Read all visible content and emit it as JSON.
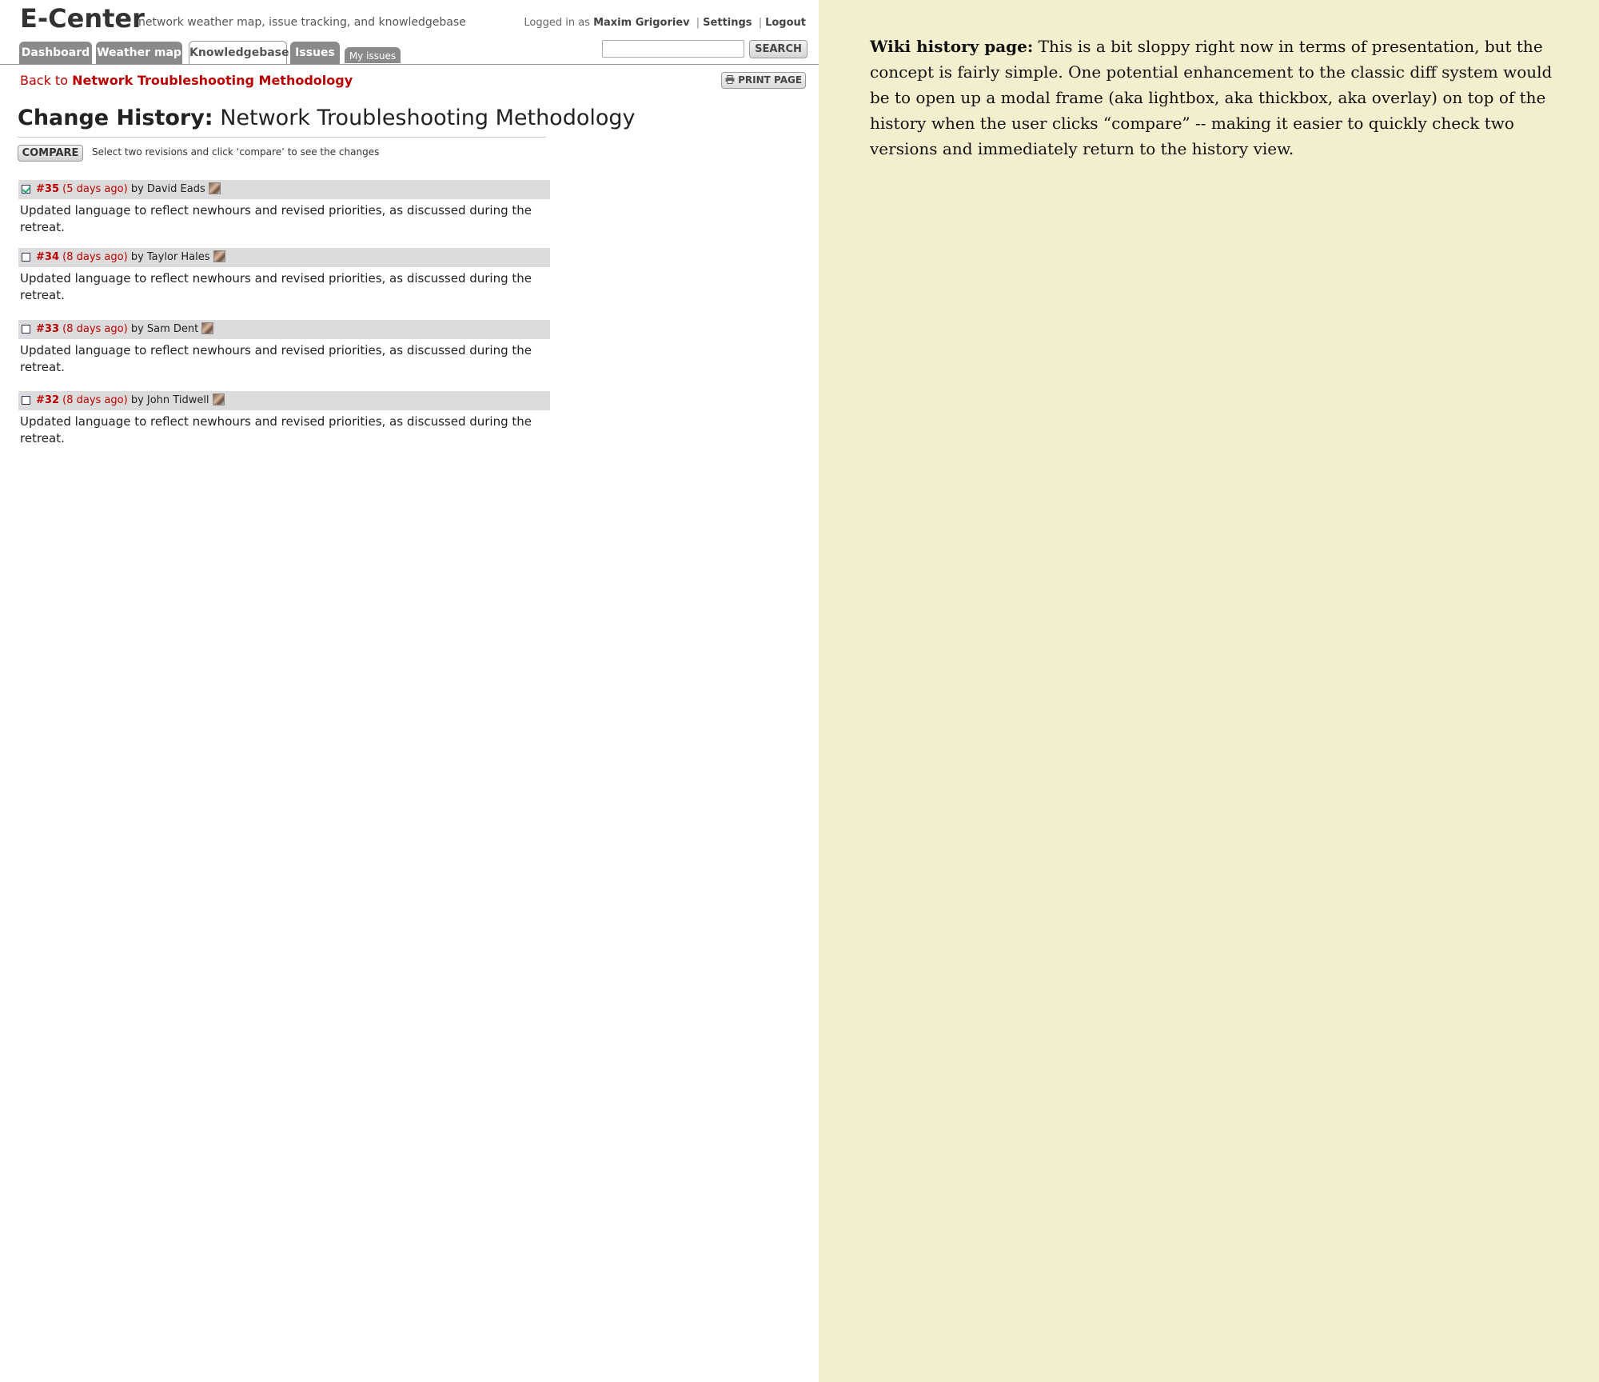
{
  "app": {
    "logo": "E-Center",
    "tagline": "network weather map, issue tracking, and knowledgebase",
    "logged_in_prefix": "Logged in as",
    "user_name": "Maxim Grigoriev",
    "separator": "|",
    "settings_link": "Settings",
    "logout_link": "Logout",
    "search_button": "SEARCH",
    "search_value": ""
  },
  "tabs": [
    {
      "label": "Dashboard"
    },
    {
      "label": "Weather map"
    },
    {
      "label": "Knowledgebase"
    },
    {
      "label": "Issues"
    },
    {
      "label": "My issues"
    }
  ],
  "page": {
    "back_prefix": "Back to",
    "back_target": "Network Troubleshooting Methodology",
    "print_button": "PRINT PAGE",
    "title_label": "Change History:",
    "title_page": "Network Troubleshooting Methodology",
    "compare_button": "COMPARE",
    "compare_hint": "Select two revisions and click ‘compare’ to see the changes"
  },
  "revisions": [
    {
      "num": "#35",
      "age": "(5 days ago)",
      "by": "by David Eads",
      "checked": true,
      "text": "Updated language to reflect newhours and revised priorities, as  discussed during the retreat."
    },
    {
      "num": "#34",
      "age": "(8 days ago)",
      "by": "by Taylor Hales",
      "checked": false,
      "text": "Updated language to reflect newhours and revised priorities, as  discussed during the retreat."
    },
    {
      "num": "#33",
      "age": "(8 days ago)",
      "by": "by Sam Dent",
      "checked": false,
      "text": "Updated language to reflect newhours and revised priorities, as  discussed during the retreat."
    },
    {
      "num": "#32",
      "age": "(8 days ago)",
      "by": "by John Tidwell",
      "checked": false,
      "text": "Updated language to reflect newhours and revised priorities, as  discussed during the retreat."
    }
  ],
  "note": {
    "heading": "Wiki history page:",
    "body": "This is a bit sloppy right now in terms of presentation, but the concept is fairly simple.  One potential enhancement to the classic diff system would be to open up a modal frame (aka lightbox, aka thickbox, aka overlay) on top of the history when the user clicks “compare” -- making it easier to quickly check two versions and immediately return to the history view."
  },
  "colors": {
    "accent_red": "#bb0000",
    "tab_gray": "#8a8a8a",
    "note_background": "#f3eecd",
    "revision_header": "#dcdcdc"
  },
  "icons": {
    "avatar": "avatar",
    "print": "printer-icon",
    "checkbox": "checkbox"
  }
}
